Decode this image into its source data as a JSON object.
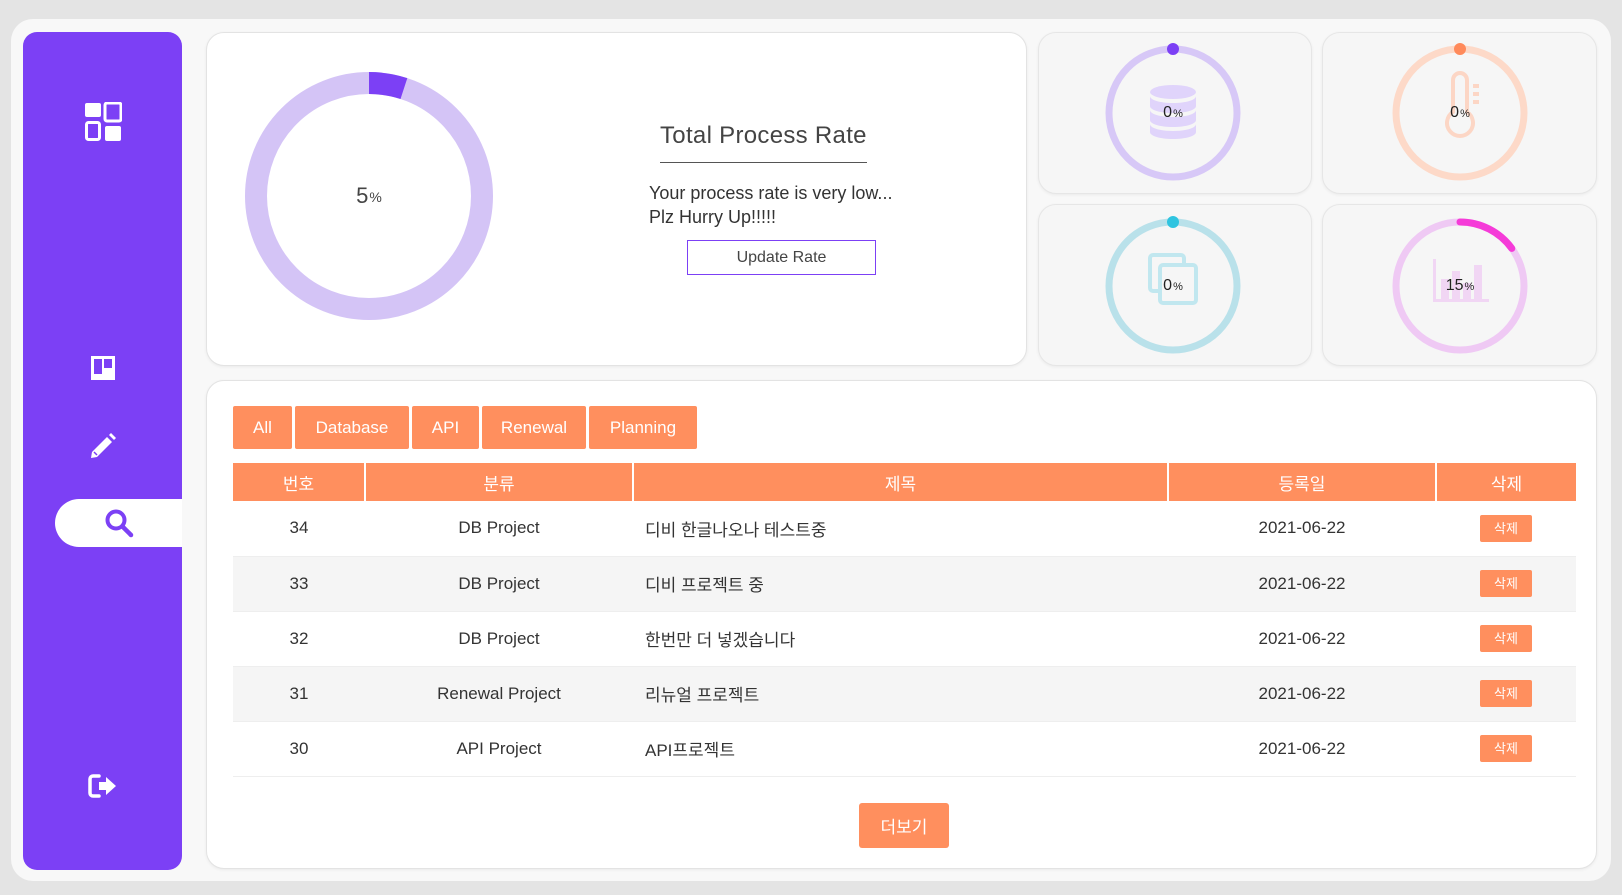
{
  "sidebar": {
    "items": [
      {
        "icon": "dashboard-icon"
      },
      {
        "icon": "board-icon"
      },
      {
        "icon": "pencil-icon"
      },
      {
        "icon": "search-icon",
        "active": true
      },
      {
        "icon": "logout-icon"
      }
    ],
    "color": "#7c40f5"
  },
  "process": {
    "value": "5",
    "unit": "%",
    "percent": 5,
    "title": "Total Process Rate",
    "message_line1": "Your process rate is very low...",
    "message_line2": "Plz Hurry Up!!!!!",
    "update_button": "Update Rate"
  },
  "mini_stats": [
    {
      "icon": "database-icon",
      "value": "0",
      "unit": "%",
      "percent": 0,
      "color": "#7c40f5",
      "track": "#d7c8f7"
    },
    {
      "icon": "thermometer-icon",
      "value": "0",
      "unit": "%",
      "percent": 0,
      "color": "#ff8a5b",
      "track": "#fdd9c8"
    },
    {
      "icon": "copy-icon",
      "value": "0",
      "unit": "%",
      "percent": 0,
      "color": "#2fc4e0",
      "track": "#b9e1ea"
    },
    {
      "icon": "bar-chart-icon",
      "value": "15",
      "unit": "%",
      "percent": 15,
      "color": "#f53bd8",
      "track": "#efc9f4"
    }
  ],
  "filters": [
    "All",
    "Database",
    "API",
    "Renewal",
    "Planning"
  ],
  "table": {
    "headers": [
      "번호",
      "분류",
      "제목",
      "등록일",
      "삭제"
    ],
    "rows": [
      {
        "no": "34",
        "category": "DB Project",
        "title": "디비 한글나오나 테스트중",
        "date": "2021-06-22",
        "delete": "삭제"
      },
      {
        "no": "33",
        "category": "DB Project",
        "title": "디비 프로젝트 중",
        "date": "2021-06-22",
        "delete": "삭제"
      },
      {
        "no": "32",
        "category": "DB Project",
        "title": "한번만 더 넣겠습니다",
        "date": "2021-06-22",
        "delete": "삭제"
      },
      {
        "no": "31",
        "category": "Renewal Project",
        "title": "리뉴얼 프로젝트",
        "date": "2021-06-22",
        "delete": "삭제"
      },
      {
        "no": "30",
        "category": "API Project",
        "title": "API프로젝트",
        "date": "2021-06-22",
        "delete": "삭제"
      }
    ]
  },
  "more_button": "더보기",
  "accent": "#ff8f5e"
}
